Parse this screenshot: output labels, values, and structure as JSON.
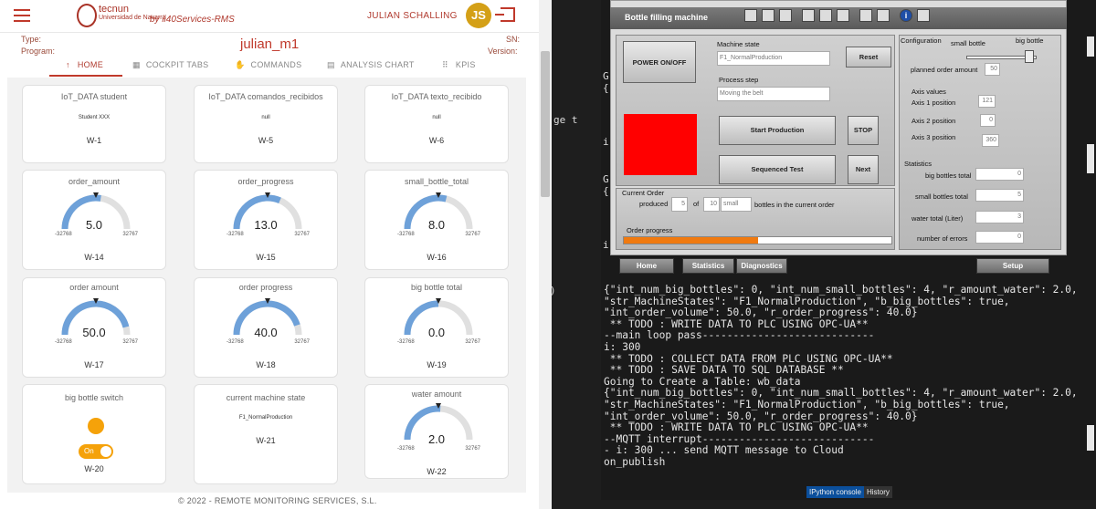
{
  "header": {
    "logo_name": "tecnun",
    "logo_sub": "Universidad de Navarra",
    "by": "by ii40Services-RMS",
    "user": "JULIAN SCHALLING",
    "avatar": "JS"
  },
  "meta": {
    "type_label": "Type:",
    "program_label": "Program:",
    "sn_label": "SN:",
    "version_label": "Version:"
  },
  "title": "julian_m1",
  "tabs": [
    "HOME",
    "COCKPIT TABS",
    "COMMANDS",
    "ANALYSIS CHART",
    "KPIS"
  ],
  "text_cards": [
    {
      "title": "IoT_DATA student",
      "value": "Student XXX",
      "id": "W-1"
    },
    {
      "title": "IoT_DATA comandos_recibidos",
      "value": "null",
      "id": "W-5"
    },
    {
      "title": "IoT_DATA texto_recibido",
      "value": "null",
      "id": "W-6"
    }
  ],
  "gauges": [
    {
      "title": "order_amount",
      "value": "5.0",
      "min": "-32768",
      "max": "32767",
      "id": "W-14"
    },
    {
      "title": "order_progress",
      "value": "13.0",
      "min": "-32768",
      "max": "32767",
      "id": "W-15"
    },
    {
      "title": "small_bottle_total",
      "value": "8.0",
      "min": "-32768",
      "max": "32767",
      "id": "W-16"
    },
    {
      "title": "order amount",
      "value": "50.0",
      "min": "-32768",
      "max": "32767",
      "id": "W-17"
    },
    {
      "title": "order progress",
      "value": "40.0",
      "min": "-32768",
      "max": "32767",
      "id": "W-18"
    },
    {
      "title": "big bottle total",
      "value": "0.0",
      "min": "-32768",
      "max": "32767",
      "id": "W-19"
    }
  ],
  "switch_card": {
    "title": "big bottle switch",
    "state": "On",
    "id": "W-20"
  },
  "state_card": {
    "title": "current machine state",
    "value": "F1_NormalProduction",
    "id": "W-21"
  },
  "water_card": {
    "title": "water amount",
    "value": "2.0",
    "min": "-32768",
    "max": "32767",
    "id": "W-22"
  },
  "footer": "© 2022 - REMOTE MONITORING SERVICES, S.L.",
  "plc": {
    "title": "Bottle filling machine",
    "power": "POWER ON/OFF",
    "machine_state_label": "Machine state",
    "machine_state": "F1_NormalProduction",
    "process_step_label": "Process step",
    "process_step": "Moving the belt",
    "reset": "Reset",
    "start": "Start Production",
    "stop": "STOP",
    "seq": "Sequenced Test",
    "next": "Next",
    "config_label": "Configuration",
    "small_bottle": "small bottle",
    "big_bottle": "big bottle",
    "planned_label": "planned order amount",
    "planned": "50",
    "axis_values_label": "Axis values",
    "axis1_label": "Axis 1 position",
    "axis1": "121",
    "axis2_label": "Axis 2 position",
    "axis2": "0",
    "axis3_label": "Axis 3 position",
    "axis3": "360",
    "stats_label": "Statistics",
    "big_total_label": "big bottles total",
    "big_total": "0",
    "small_total_label": "small bottles total",
    "small_total": "5",
    "water_label": "water total (Liter)",
    "water": "3",
    "errors_label": "number of errors",
    "errors": "0",
    "current_order_label": "Current Order",
    "produced_label": "produced",
    "produced": "5",
    "of_label": "of",
    "order_total": "10",
    "order_kind": "small",
    "bottles_text": "bottles in the current order",
    "order_progress_label": "Order progress",
    "order_progress_value": 0.5,
    "nav": [
      "Home",
      "Statistics",
      "Diagnostics",
      "Setup"
    ]
  },
  "terminal": {
    "lines": [
      "{\"int_num_big_bottles\": 0, \"int_num_small_bottles\": 4, \"r_amount_water\": 2.0,",
      "\"str_MachineStates\": \"F1_NormalProduction\", \"b_big_bottles\": true,",
      "\"int_order_volume\": 50.0, \"r_order_progress\": 40.0}",
      " ** TODO : WRITE DATA TO PLC USING OPC-UA**",
      "--main loop pass----------------------------",
      "i: 300",
      " ** TODO : COLLECT DATA FROM PLC USING OPC-UA**",
      " ** TODO : SAVE DATA TO SQL DATABASE **",
      "Going to Create a Table: wb_data",
      "{\"int_num_big_bottles\": 0, \"int_num_small_bottles\": 4, \"r_amount_water\": 2.0,",
      "\"str_MachineStates\": \"F1_NormalProduction\", \"b_big_bottles\": true,",
      "\"int_order_volume\": 50.0, \"r_order_progress\": 40.0}",
      " ** TODO : WRITE DATA TO PLC USING OPC-UA**",
      "--MQTT interrupt----------------------------",
      "- i: 300 ... send MQTT message to Cloud",
      "on_publish"
    ],
    "tab_console": "IPython console",
    "tab_history": "History"
  }
}
